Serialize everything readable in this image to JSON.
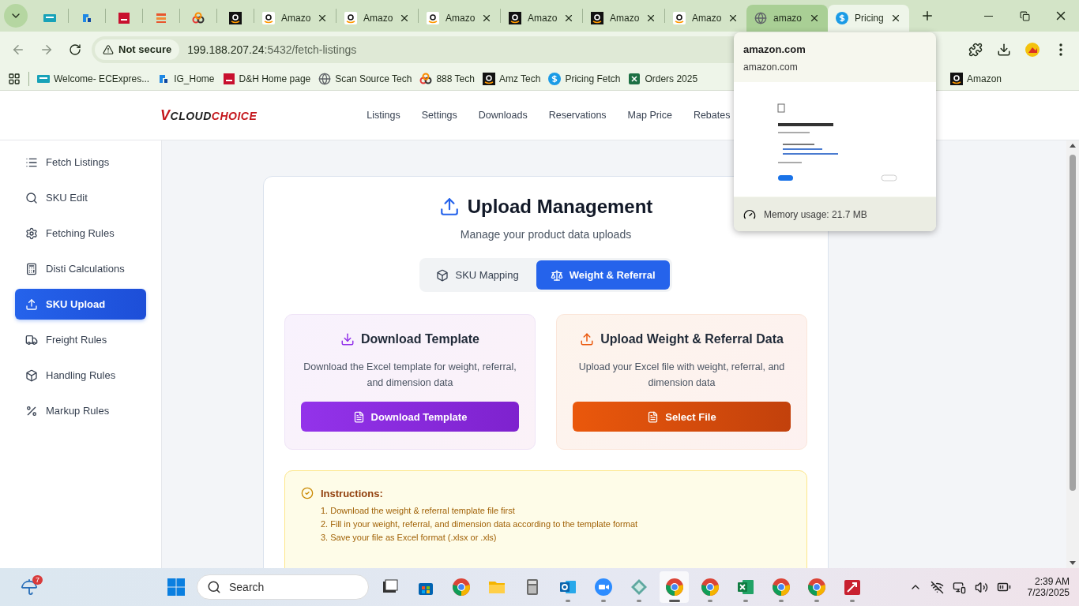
{
  "browser": {
    "tabs": [
      {
        "kind": "ec",
        "selected": false,
        "hovered": false
      },
      {
        "kind": "ig",
        "selected": false,
        "hovered": false
      },
      {
        "kind": "dh",
        "selected": false,
        "hovered": false
      },
      {
        "kind": "stack",
        "selected": false,
        "hovered": false
      },
      {
        "kind": "rings",
        "selected": false,
        "hovered": false
      },
      {
        "kind": "amazon-dark",
        "selected": false,
        "hovered": false
      },
      {
        "kind": "amazon",
        "title": "Amazo",
        "selected": false,
        "hovered": false
      },
      {
        "kind": "amazon",
        "title": "Amazo",
        "selected": false,
        "hovered": false
      },
      {
        "kind": "amazon",
        "title": "Amazo",
        "selected": false,
        "hovered": false
      },
      {
        "kind": "amazon-dark",
        "title": "Amazo",
        "selected": false,
        "hovered": false
      },
      {
        "kind": "amazon-dark",
        "title": "Amazo",
        "selected": false,
        "hovered": false
      },
      {
        "kind": "amazon",
        "title": "Amazo",
        "selected": false,
        "hovered": false
      },
      {
        "kind": "globe",
        "title": "amazo",
        "selected": false,
        "hovered": true
      },
      {
        "kind": "dollar",
        "title": "Pricing",
        "selected": true,
        "hovered": false
      }
    ],
    "security": "Not secure",
    "url_host": "199.188.207.24",
    "url_rest": ":5432/fetch-listings",
    "bookmarks": [
      {
        "kind": "ec",
        "label": "Welcome- ECExpres..."
      },
      {
        "kind": "ig",
        "label": "IG_Home"
      },
      {
        "kind": "dh",
        "label": "D&H Home page"
      },
      {
        "kind": "globe",
        "label": "Scan Source Tech"
      },
      {
        "kind": "rings",
        "label": "888 Tech"
      },
      {
        "kind": "amazon-dark",
        "label": "Amz Tech"
      },
      {
        "kind": "dollar",
        "label": "Pricing Fetch"
      },
      {
        "kind": "excel",
        "label": "Orders 2025"
      }
    ],
    "bookmarks_right": [
      {
        "kind": "amazon-dark",
        "label": "Amazon"
      }
    ],
    "hover_card": {
      "title": "amazon.com",
      "domain": "amazon.com",
      "memory": "Memory usage: 21.7 MB"
    }
  },
  "header": {
    "logo": [
      {
        "text": "V"
      },
      {
        "text": "CLOUD"
      },
      {
        "text": "CHOICE"
      }
    ],
    "nav": [
      "Listings",
      "Settings",
      "Downloads",
      "Reservations",
      "Map Price",
      "Rebates"
    ]
  },
  "sidebar": {
    "items": [
      {
        "kind": "list",
        "label": "Fetch Listings",
        "selected": false
      },
      {
        "kind": "search",
        "label": "SKU Edit",
        "selected": false
      },
      {
        "kind": "gear",
        "label": "Fetching Rules",
        "selected": false
      },
      {
        "kind": "calculator",
        "label": "Disti Calculations",
        "selected": false
      },
      {
        "kind": "upload",
        "label": "SKU Upload",
        "selected": true
      },
      {
        "kind": "truck",
        "label": "Freight Rules",
        "selected": false
      },
      {
        "kind": "box",
        "label": "Handling Rules",
        "selected": false
      },
      {
        "kind": "percent",
        "label": "Markup Rules",
        "selected": false
      }
    ]
  },
  "main": {
    "title": "Upload Management",
    "subtitle": "Manage your product data uploads",
    "tabs": [
      {
        "kind": "box",
        "label": "SKU Mapping",
        "selected": false
      },
      {
        "kind": "scale",
        "label": "Weight & Referral",
        "selected": true
      }
    ],
    "panels": [
      {
        "kind": "download",
        "title": "Download Template",
        "description": "Download the Excel template for weight, referral, and dimension data",
        "button": "Download Template"
      },
      {
        "kind": "upload",
        "title": "Upload Weight & Referral Data",
        "description": "Upload your Excel file with weight, referral, and dimension data",
        "button": "Select File"
      }
    ],
    "instructions": {
      "title": "Instructions:",
      "steps": [
        "1. Download the weight & referral template file first",
        "2. Fill in your weight, referral, and dimension data according to the template format",
        "3. Save your file as Excel format (.xlsx or .xls)"
      ]
    }
  },
  "taskbar": {
    "weather_badge": "7",
    "search": "Search",
    "apps": [
      {
        "kind": "taskview",
        "running": false,
        "selected": false
      },
      {
        "kind": "store",
        "running": false,
        "selected": false
      },
      {
        "kind": "chrome",
        "running": false,
        "selected": false
      },
      {
        "kind": "folder",
        "running": false,
        "selected": false
      },
      {
        "kind": "calculator",
        "running": false,
        "selected": false
      },
      {
        "kind": "outlook",
        "running": true,
        "selected": false
      },
      {
        "kind": "zoom",
        "running": true,
        "selected": false
      },
      {
        "kind": "diamond",
        "running": true,
        "selected": false
      },
      {
        "kind": "chrome",
        "running": true,
        "selected": true
      },
      {
        "kind": "chrome",
        "running": true,
        "selected": false
      },
      {
        "kind": "excel",
        "running": true,
        "selected": false
      },
      {
        "kind": "chrome",
        "running": true,
        "selected": false
      },
      {
        "kind": "chrome",
        "running": true,
        "selected": false
      },
      {
        "kind": "redapp",
        "running": true,
        "selected": false
      }
    ],
    "time": "2:39 AM",
    "date": "7/23/2025"
  }
}
